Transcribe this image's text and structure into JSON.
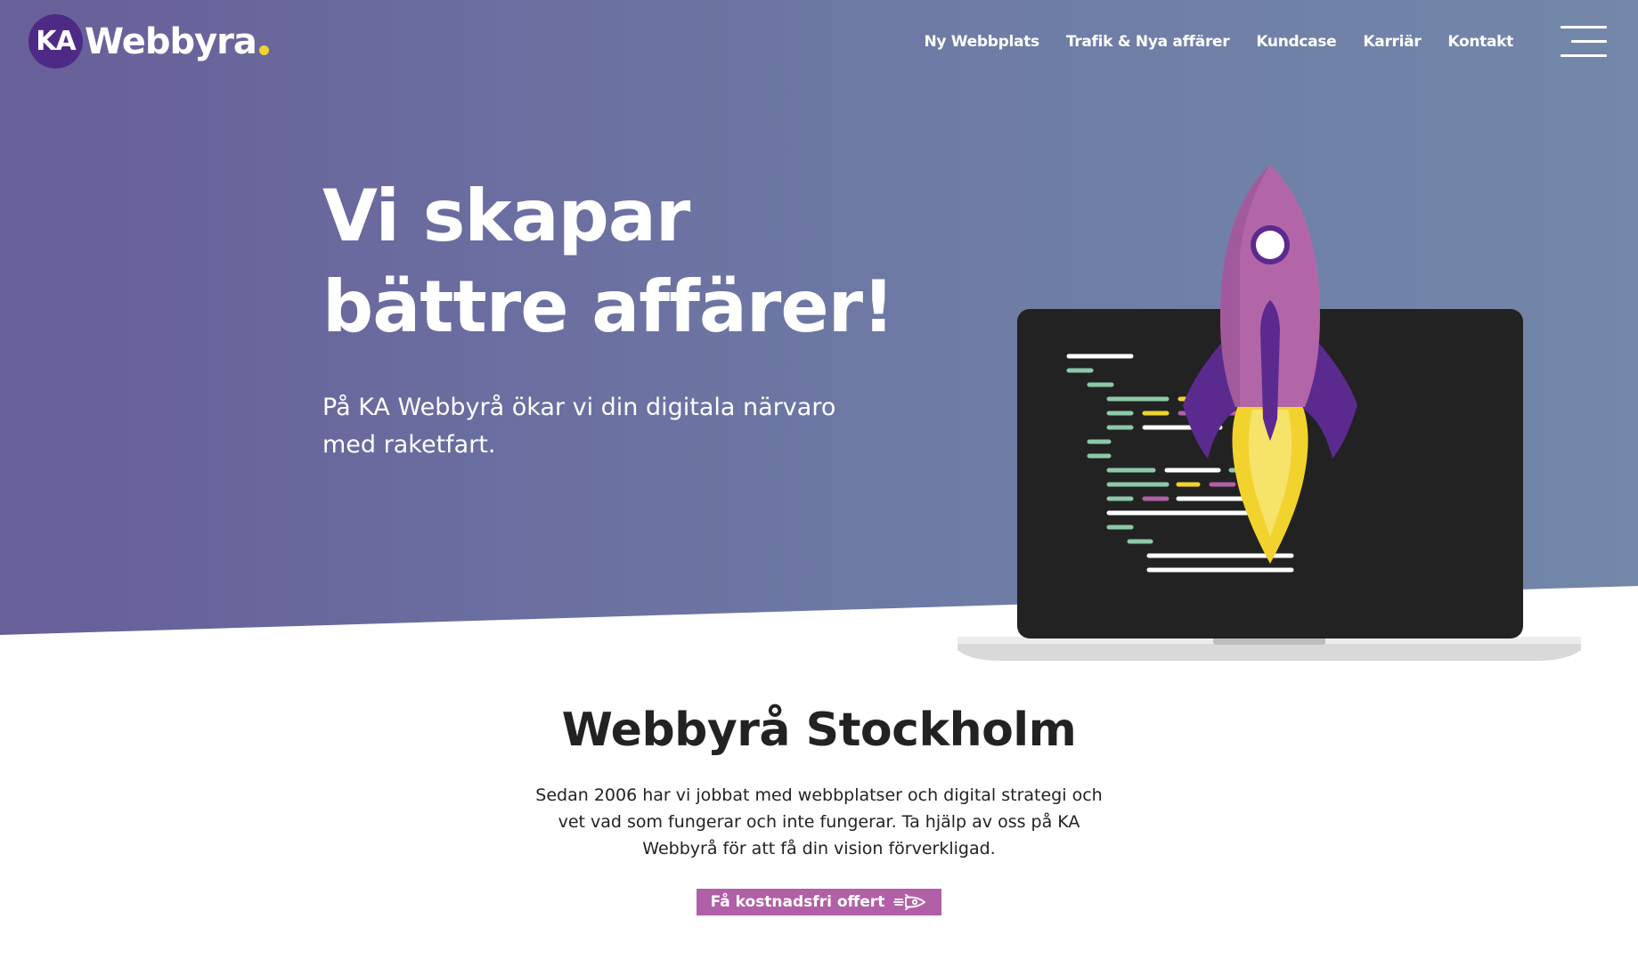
{
  "brand": {
    "logo_initials": "KA",
    "logo_word": "Webbyra",
    "accent": "#f2d32d",
    "logo_bg": "#4e2a87"
  },
  "nav": {
    "items": [
      {
        "label": "Ny Webbplats"
      },
      {
        "label": "Trafik & Nya affärer"
      },
      {
        "label": "Kundcase"
      },
      {
        "label": "Karriär"
      },
      {
        "label": "Kontakt"
      }
    ],
    "menu_icon": "hamburger-icon"
  },
  "hero": {
    "title_line1": "Vi skapar",
    "title_line2": "bättre affärer!",
    "subtitle": "På KA Webbyrå ökar vi din digitala närvaro med raketfart.",
    "illustration": "rocket-laptop-illustration"
  },
  "section": {
    "heading": "Webbyrå Stockholm",
    "body": "Sedan 2006 har vi jobbat med webbplatser och digital strategi och vet vad som fungerar och inte fungerar. Ta hjälp av oss på KA Webbyrå för att få din vision förverkligad.",
    "cta_label": "Få kostnadsfri offert",
    "cta_icon": "rocket-icon",
    "cta_color": "#b160a7"
  }
}
